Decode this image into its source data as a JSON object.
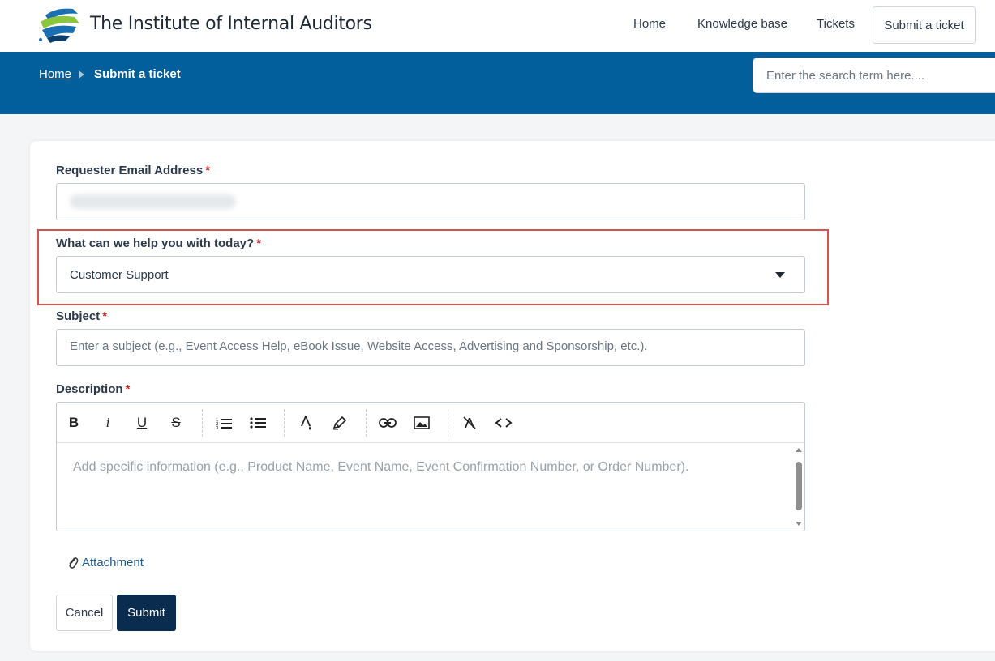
{
  "header": {
    "brand": "The Institute of Internal Auditors",
    "nav": {
      "home": "Home",
      "knowledge_base": "Knowledge base",
      "tickets": "Tickets",
      "submit_ticket": "Submit a ticket"
    },
    "logo_colors": [
      "#1a6fb0",
      "#8cc63f",
      "#0b3e6b"
    ]
  },
  "breadcrumb": {
    "home": "Home",
    "current": "Submit a ticket"
  },
  "search": {
    "placeholder": "Enter the search term here...."
  },
  "form": {
    "email_label": "Requester Email Address",
    "help_label": "What can we help you with today?",
    "help_selected": "Customer Support",
    "subject_label": "Subject",
    "subject_placeholder": "Enter a subject (e.g., Event Access Help, eBook Issue, Website Access, Advertising and Sponsorship, etc.).",
    "description_label": "Description",
    "description_placeholder": "Add specific information (e.g., Product Name, Event Name, Event Confirmation Number, or Order Number).",
    "required_mark": "*",
    "toolbar": {
      "bold": "B",
      "italic": "i",
      "underline": "U",
      "strike": "S"
    },
    "attachment_label": "Attachment",
    "cancel_label": "Cancel",
    "submit_label": "Submit"
  },
  "colors": {
    "band": "#035f9c",
    "submit": "#0a2c4f",
    "highlight": "#d9534f",
    "required": "#c62828",
    "link": "#1e5a8f"
  }
}
